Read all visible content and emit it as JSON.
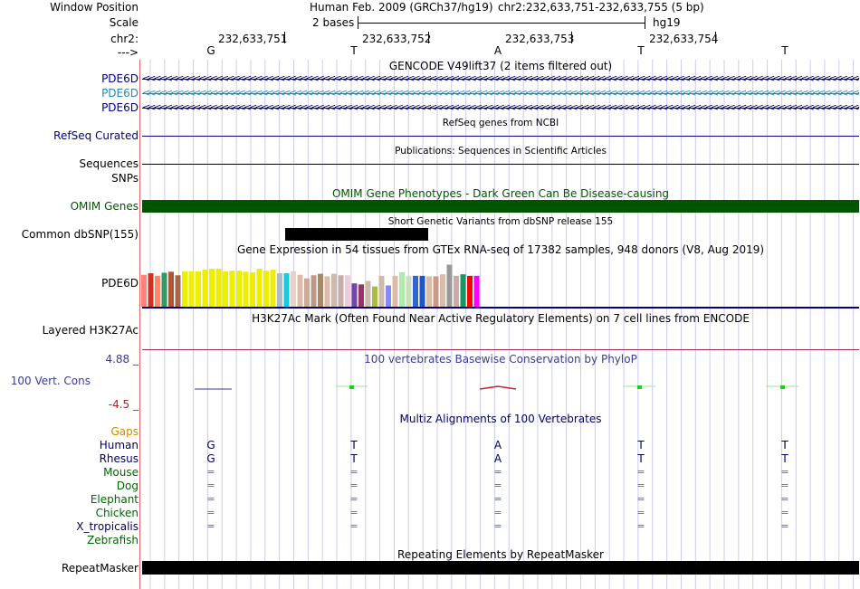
{
  "header": {
    "window_position_label": "Window Position",
    "assembly_text": "Human Feb. 2009 (GRCh37/hg19)",
    "position_text": "chr2:232,633,751-232,633,755 (5 bp)",
    "scale_label": "Scale",
    "scale_value": "2 bases",
    "scale_db": "hg19",
    "chrom_label": "chr2:",
    "strand_label": "--->",
    "coords": [
      "232,633,751",
      "232,633,752",
      "232,633,753",
      "232,633,754"
    ],
    "bases": [
      "G",
      "T",
      "A",
      "T",
      "T"
    ]
  },
  "tracks": {
    "gencode": {
      "title": "GENCODE V49lift37 (2 items filtered out)",
      "items": [
        "PDE6D",
        "PDE6D",
        "PDE6D"
      ],
      "arrow_glyph": "<"
    },
    "refseq": {
      "title": "RefSeq genes from NCBI",
      "label": "RefSeq Curated"
    },
    "publications": {
      "title": "Publications: Sequences in Scientific Articles",
      "labels": [
        "Sequences",
        "SNPs"
      ]
    },
    "omim": {
      "title": "OMIM Gene Phenotypes - Dark Green Can Be Disease-causing",
      "label": "OMIM Genes"
    },
    "dbsnp": {
      "title": "Short Genetic Variants from dbSNP release 155",
      "label": "Common dbSNP(155)"
    },
    "gtex": {
      "title": "Gene Expression in 54 tissues from GTEx RNA-seq of 17382 samples, 948 donors (V8, Aug 2019)",
      "label": "PDE6D",
      "bars": [
        {
          "value": 0.63,
          "color": "#ff8080"
        },
        {
          "value": 0.66,
          "color": "#cc3322"
        },
        {
          "value": 0.61,
          "color": "#ff8866"
        },
        {
          "value": 0.67,
          "color": "#339966"
        },
        {
          "value": 0.69,
          "color": "#b05533"
        },
        {
          "value": 0.62,
          "color": "#aa6644"
        },
        {
          "value": 0.7,
          "color": "#eeee00"
        },
        {
          "value": 0.7,
          "color": "#eeee00"
        },
        {
          "value": 0.7,
          "color": "#eeee00"
        },
        {
          "value": 0.73,
          "color": "#eeee00"
        },
        {
          "value": 0.75,
          "color": "#eeee00"
        },
        {
          "value": 0.75,
          "color": "#eeee00"
        },
        {
          "value": 0.7,
          "color": "#eeee00"
        },
        {
          "value": 0.71,
          "color": "#eeee00"
        },
        {
          "value": 0.71,
          "color": "#eeee00"
        },
        {
          "value": 0.69,
          "color": "#eeee00"
        },
        {
          "value": 0.68,
          "color": "#eeee00"
        },
        {
          "value": 0.75,
          "color": "#eeee00"
        },
        {
          "value": 0.71,
          "color": "#eeee00"
        },
        {
          "value": 0.73,
          "color": "#eeee00"
        },
        {
          "value": 0.66,
          "color": "#aabbcc"
        },
        {
          "value": 0.66,
          "color": "#11ccdd"
        },
        {
          "value": 0.7,
          "color": "#e6d2c6"
        },
        {
          "value": 0.63,
          "color": "#ddbbaa"
        },
        {
          "value": 0.56,
          "color": "#ccaa99"
        },
        {
          "value": 0.62,
          "color": "#bb9988"
        },
        {
          "value": 0.65,
          "color": "#aa8866"
        },
        {
          "value": 0.6,
          "color": "#ddbbaa"
        },
        {
          "value": 0.65,
          "color": "#ccbbaa"
        },
        {
          "value": 0.62,
          "color": "#ccaaaa"
        },
        {
          "value": 0.62,
          "color": "#eeccdd"
        },
        {
          "value": 0.46,
          "color": "#7744aa"
        },
        {
          "value": 0.44,
          "color": "#993366"
        },
        {
          "value": 0.51,
          "color": "#ccbbaa"
        },
        {
          "value": 0.4,
          "color": "#aabb44"
        },
        {
          "value": 0.61,
          "color": "#ccbbaa"
        },
        {
          "value": 0.42,
          "color": "#8888ff"
        },
        {
          "value": 0.61,
          "color": "#ddbbaa"
        },
        {
          "value": 0.68,
          "color": "#aaeeaa"
        },
        {
          "value": 0.61,
          "color": "#ccddbb"
        },
        {
          "value": 0.61,
          "color": "#3366cc"
        },
        {
          "value": 0.61,
          "color": "#2255cc"
        },
        {
          "value": 0.6,
          "color": "#ddbbaa"
        },
        {
          "value": 0.6,
          "color": "#cc9988"
        },
        {
          "value": 0.64,
          "color": "#ddbbaa"
        },
        {
          "value": 0.83,
          "color": "#999999"
        },
        {
          "value": 0.61,
          "color": "#ccaaaa"
        },
        {
          "value": 0.64,
          "color": "#119966"
        },
        {
          "value": 0.61,
          "color": "#ff0000"
        },
        {
          "value": 0.61,
          "color": "#ff00ff"
        }
      ]
    },
    "h3k27ac": {
      "title": "H3K27Ac Mark (Often Found Near Active Regulatory Elements) on 7 cell lines from ENCODE",
      "label": "Layered H3K27Ac"
    },
    "phylop": {
      "title": "100 vertebrates Basewise Conservation by PhyloP",
      "label": "100 Vert. Cons",
      "max_label": "4.88 _",
      "min_label": "-4.5 _"
    },
    "multiz": {
      "title": "Multiz Alignments of 100 Vertebrates",
      "gaps_label": "Gaps",
      "species": [
        {
          "name": "Human",
          "color": "#000066",
          "row": [
            "G",
            "T",
            "A",
            "T",
            "T"
          ]
        },
        {
          "name": "Rhesus",
          "color": "#000066",
          "row": [
            "G",
            "T",
            "A",
            "T",
            "T"
          ]
        },
        {
          "name": "Mouse",
          "color": "#006600",
          "row": [
            "=",
            "=",
            "=",
            "=",
            "="
          ]
        },
        {
          "name": "Dog",
          "color": "#006600",
          "row": [
            "=",
            "=",
            "=",
            "=",
            "="
          ]
        },
        {
          "name": "Elephant",
          "color": "#006600",
          "row": [
            "=",
            "=",
            "=",
            "=",
            "="
          ]
        },
        {
          "name": "Chicken",
          "color": "#006600",
          "row": [
            "=",
            "=",
            "=",
            "=",
            "="
          ]
        },
        {
          "name": "X_tropicalis",
          "color": "#000066",
          "row": [
            "=",
            "=",
            "=",
            "=",
            "="
          ]
        },
        {
          "name": "Zebrafish",
          "color": "#006600",
          "row": [
            "",
            "",
            "",
            "",
            ""
          ]
        }
      ]
    },
    "repeatmasker": {
      "title": "Repeating Elements by RepeatMasker",
      "label": "RepeatMasker"
    }
  },
  "colors": {
    "gencode_dark": "#000080",
    "gencode_light": "#2288bb",
    "omim_green": "#005500",
    "phylop_blue": "#3a3a9a",
    "phylop_red": "#aa2222",
    "guide_line": "#ccccee",
    "gaps_orange": "#cc8800"
  }
}
